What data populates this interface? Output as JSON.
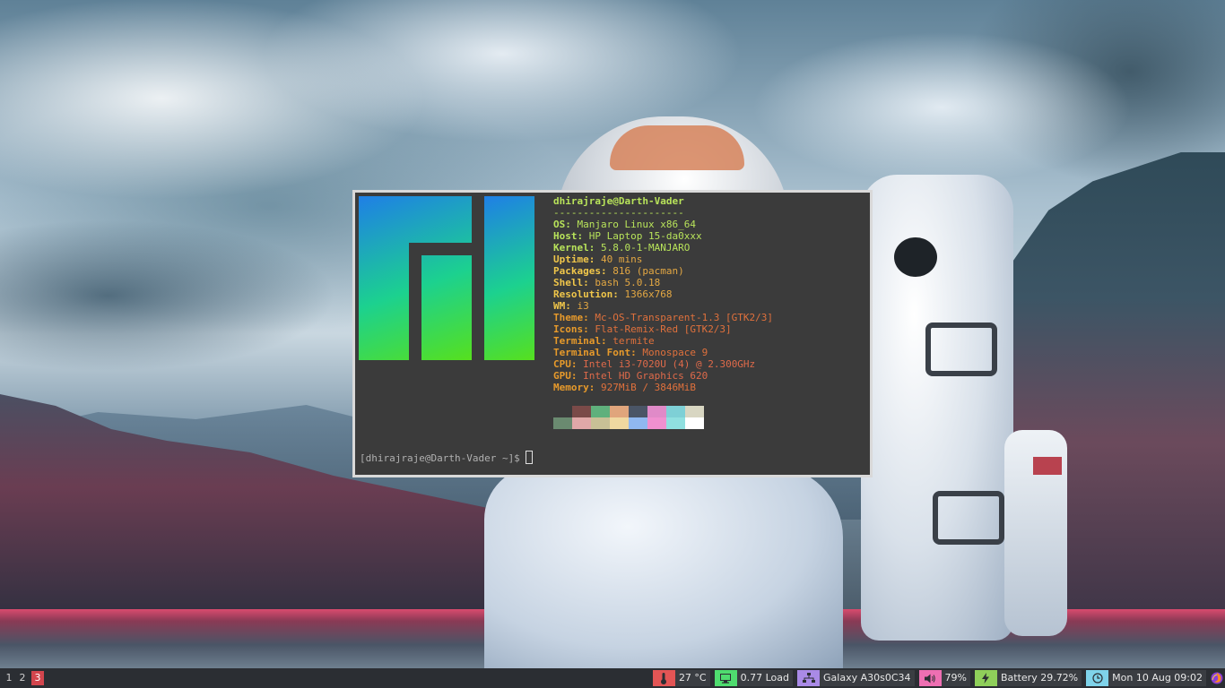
{
  "terminal": {
    "title_line": "dhirajraje@Darth-Vader",
    "separator": "----------------------",
    "fields": [
      {
        "key": "OS",
        "value": "Manjaro Linux x86_64"
      },
      {
        "key": "Host",
        "value": "HP Laptop 15-da0xxx"
      },
      {
        "key": "Kernel",
        "value": "5.8.0-1-MANJARO"
      },
      {
        "key": "Uptime",
        "value": "40 mins"
      },
      {
        "key": "Packages",
        "value": "816 (pacman)"
      },
      {
        "key": "Shell",
        "value": "bash 5.0.18"
      },
      {
        "key": "Resolution",
        "value": "1366x768"
      },
      {
        "key": "WM",
        "value": "i3"
      },
      {
        "key": "Theme",
        "value": "Mc-OS-Transparent-1.3 [GTK2/3]"
      },
      {
        "key": "Icons",
        "value": "Flat-Remix-Red [GTK2/3]"
      },
      {
        "key": "Terminal",
        "value": "termite"
      },
      {
        "key": "Terminal Font",
        "value": "Monospace 9"
      },
      {
        "key": "CPU",
        "value": "Intel i3-7020U (4) @ 2.300GHz"
      },
      {
        "key": "GPU",
        "value": "Intel HD Graphics 620"
      },
      {
        "key": "Memory",
        "value": "927MiB / 3846MiB"
      }
    ],
    "colors": {
      "row1": [
        "#3b3b3b",
        "#7a4a48",
        "#5fb07c",
        "#e0a57c",
        "#4a5566",
        "#e08ac8",
        "#7ed0d6",
        "#d8d6c2"
      ],
      "row2": [
        "#6a8a70",
        "#e0a8a8",
        "#c8c096",
        "#f0d8a0",
        "#90b8f0",
        "#f090d0",
        "#90e0e0",
        "#ffffff"
      ]
    },
    "prompt": "[dhirajraje@Darth-Vader ~]$ "
  },
  "workspaces": [
    {
      "label": "1",
      "active": false
    },
    {
      "label": "2",
      "active": false
    },
    {
      "label": "3",
      "active": true
    }
  ],
  "status": {
    "temperature": {
      "text": "27 °C",
      "color": "#e35555",
      "icon": "thermometer-icon"
    },
    "load": {
      "text": "0.77 Load",
      "color": "#4fdc6f",
      "icon": "monitor-icon"
    },
    "network": {
      "text": "Galaxy A30s0C34",
      "color": "#a98ae6",
      "icon": "network-icon"
    },
    "volume": {
      "text": "79%",
      "color": "#ee6fb2",
      "icon": "speaker-icon"
    },
    "battery": {
      "text": "Battery 29.72%",
      "color": "#8fcf5a",
      "icon": "battery-bolt-icon"
    },
    "clock": {
      "text": "Mon 10 Aug 09:02",
      "color": "#7fd3ea",
      "icon": "clock-icon"
    }
  }
}
